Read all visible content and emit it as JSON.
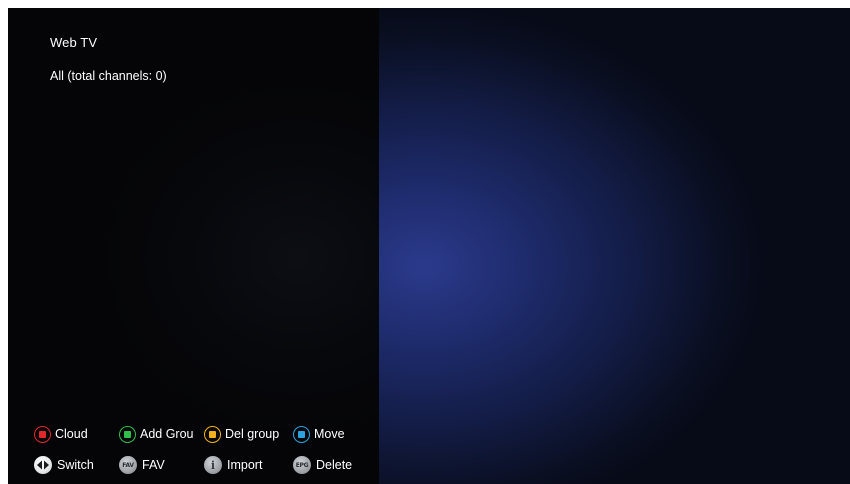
{
  "screen": {
    "title": "Web TV",
    "subtitle": "All (total channels: 0)"
  },
  "hints": {
    "row1": [
      {
        "label": "Cloud",
        "icon": "red-button-icon",
        "color": "#e0282a"
      },
      {
        "label": "Add Grou",
        "icon": "green-button-icon",
        "color": "#2fbf4a"
      },
      {
        "label": "Del group",
        "icon": "yellow-button-icon",
        "color": "#f2b21b"
      },
      {
        "label": "Move",
        "icon": "blue-button-icon",
        "color": "#2aa3e0"
      }
    ],
    "row2": [
      {
        "label": "Switch",
        "icon": "left-right-arrows-icon",
        "glyph": "◀▶"
      },
      {
        "label": "FAV",
        "icon": "fav-button-icon",
        "glyph": "FAV"
      },
      {
        "label": "Import",
        "icon": "info-button-icon",
        "glyph": "i"
      },
      {
        "label": "Delete",
        "icon": "epg-button-icon",
        "glyph": "EPG"
      }
    ]
  }
}
